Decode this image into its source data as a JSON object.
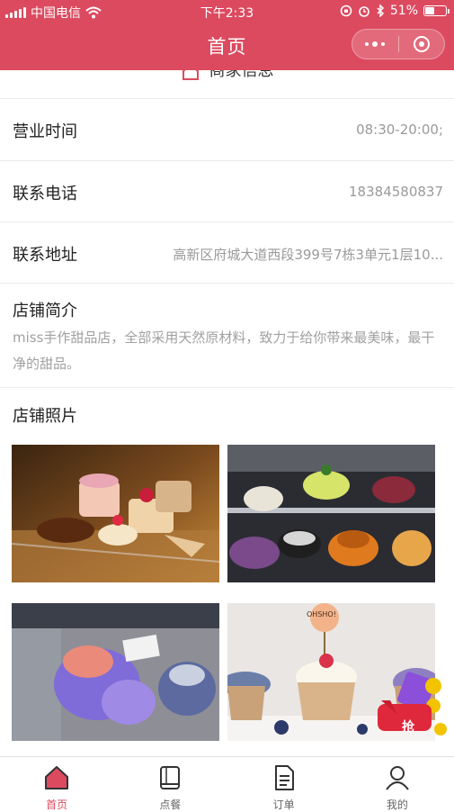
{
  "status_bar": {
    "carrier": "中国电信",
    "time": "下午2:33",
    "battery_percent": "51%",
    "battery_level": 0.51
  },
  "nav": {
    "title": "首页"
  },
  "section": {
    "title": "商家信息"
  },
  "info": {
    "hours_label": "营业时间",
    "hours_value": "08:30-20:00;",
    "phone_label": "联系电话",
    "phone_value": "18384580837",
    "address_label": "联系地址",
    "address_value": "高新区府城大道西段399号7栋3单元1层10..."
  },
  "intro": {
    "title": "店铺简介",
    "text": "miss手作甜品店，全部采用天然原材料，致力于给你带来最美味，最干净的甜品。"
  },
  "photos": {
    "title": "店铺照片",
    "items": [
      "cake-display-photo",
      "cake-cabinet-photo",
      "gelato-case-photo",
      "cupcakes-photo"
    ],
    "cupcake_topper": "OHSHO!"
  },
  "promo": {
    "grab_label": "抢"
  },
  "tabs": [
    {
      "label": "首页",
      "icon": "home-icon",
      "active": true
    },
    {
      "label": "点餐",
      "icon": "book-icon",
      "active": false
    },
    {
      "label": "订单",
      "icon": "document-icon",
      "active": false
    },
    {
      "label": "我的",
      "icon": "person-icon",
      "active": false
    }
  ],
  "colors": {
    "brand": "#dc4a5f",
    "muted_text": "#9a9a9a",
    "divider": "#ececec"
  }
}
